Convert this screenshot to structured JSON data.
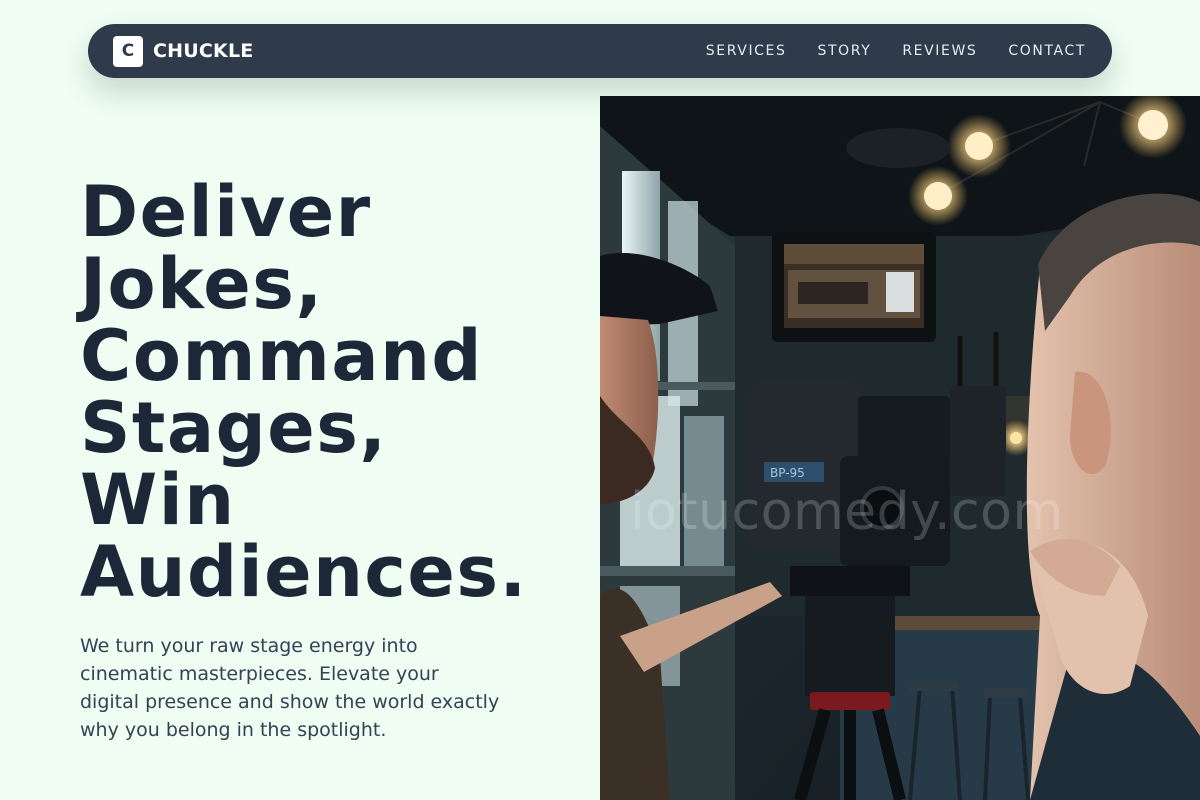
{
  "brand": {
    "logo_letter": "C",
    "name": "CHUCKLE"
  },
  "nav": {
    "links": [
      {
        "label": "SERVICES"
      },
      {
        "label": "STORY"
      },
      {
        "label": "REVIEWS"
      },
      {
        "label": "CONTACT"
      }
    ]
  },
  "hero": {
    "title_lines": [
      "Deliver",
      "Jokes,",
      "Command",
      "Stages,",
      "Win",
      "Audiences."
    ],
    "subtitle": "We turn your raw stage energy into cinematic masterpieces. Elevate your digital presence and show the world exactly why you belong in the spotlight.",
    "image": {
      "watermark": "iotucomedy.com",
      "camera_label": "BP-95"
    }
  },
  "colors": {
    "page_background": "#effdf2",
    "nav_background": "#2f3a4a",
    "title_text": "#1c2738",
    "body_text": "#334254"
  },
  "icons": {
    "logo": "c-logo-icon"
  }
}
